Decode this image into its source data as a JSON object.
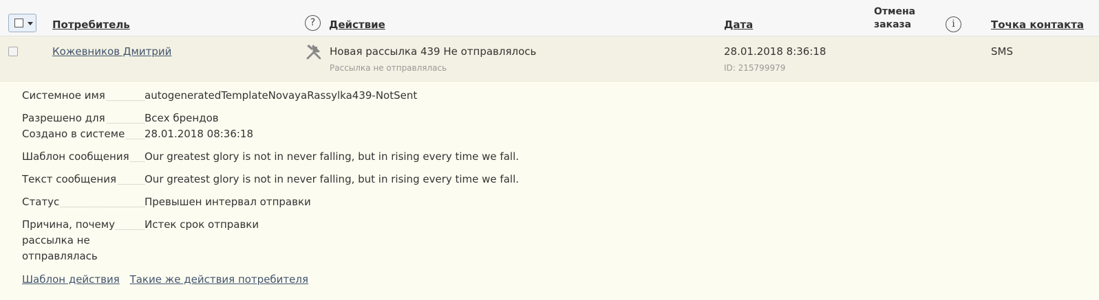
{
  "header": {
    "columns": {
      "consumer": "Потребитель",
      "action": "Действие",
      "date": "Дата",
      "cancel_line1": "Отмена",
      "cancel_line2": "заказа",
      "contact_point": "Точка контакта"
    },
    "help_icon_glyph": "?",
    "info_icon_glyph": "i"
  },
  "row": {
    "consumer_name": "Кожевников Дмитрий",
    "action_title": "Новая рассылка 439 Не отправлялось",
    "action_subtitle": "Рассылка не отправлялась",
    "date": "28.01.2018 8:36:18",
    "id": "ID: 215799979",
    "contact_point": "SMS",
    "action_icon": "tools-icon"
  },
  "details": {
    "system_name_label": "Системное имя",
    "system_name_value": "autogeneratedTemplateNovayaRassylka439-NotSent",
    "allowed_for_label": "Разрешено для",
    "allowed_for_value": "Всех брендов",
    "created_label": "Создано в системе",
    "created_value": "28.01.2018 08:36:18",
    "template_label": "Шаблон сообщения",
    "template_value": "Our greatest glory is not in never falling, but in rising every time we fall.",
    "text_label": "Текст сообщения",
    "text_value": "Our greatest glory is not in never falling, but in rising every time we fall.",
    "status_label": "Статус",
    "status_value": "Превышен интервал отправки",
    "reason_label": "Причина, почему рассылка не отправлялась",
    "reason_value": "Истек срок отправки"
  },
  "links": {
    "action_template": "Шаблон действия",
    "same_actions": "Такие же действия потребителя"
  },
  "colors": {
    "link": "#41546e",
    "details_bg": "#fdfcf0",
    "row_bg": "#f3f1e3",
    "header_bg": "#f7f7f7"
  }
}
